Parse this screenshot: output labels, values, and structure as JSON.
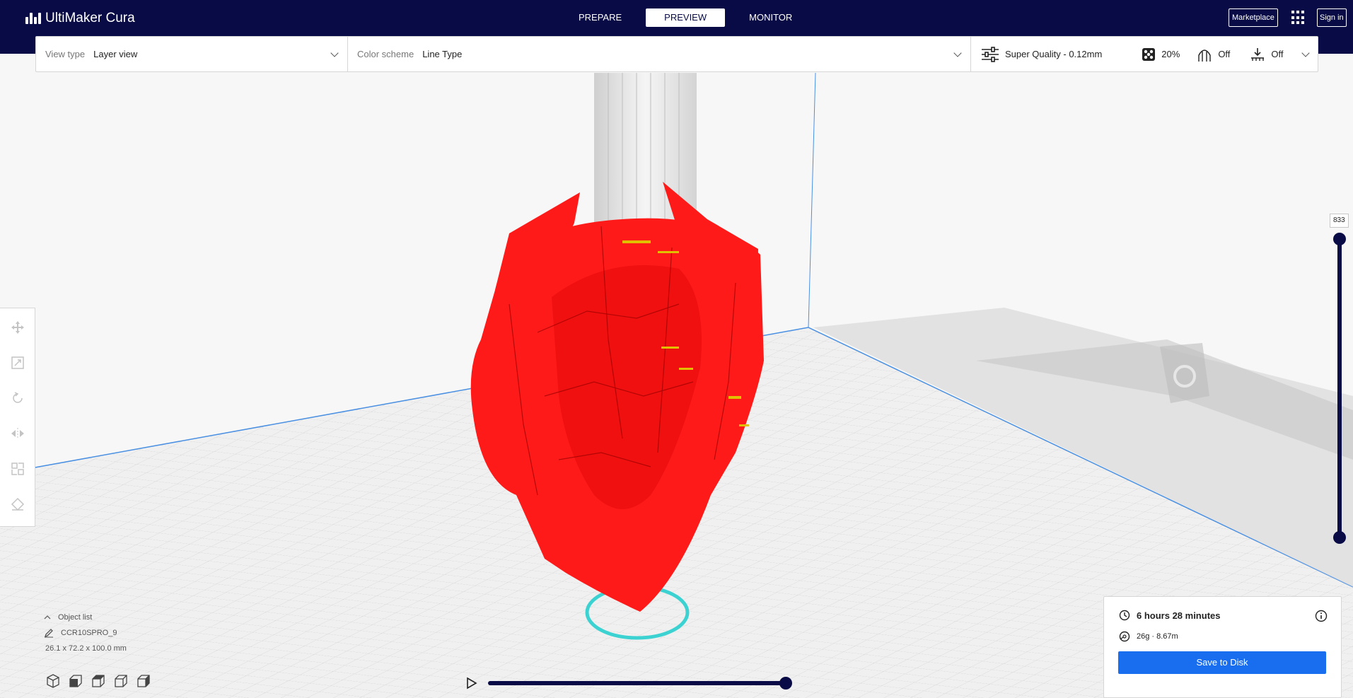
{
  "app": {
    "title": "UltiMaker Cura"
  },
  "nav": {
    "tabs": [
      "PREPARE",
      "PREVIEW",
      "MONITOR"
    ],
    "active": "PREVIEW"
  },
  "header": {
    "marketplace": "Marketplace",
    "sign_in": "Sign in"
  },
  "options": {
    "view_type_label": "View type",
    "view_type_value": "Layer view",
    "color_scheme_label": "Color scheme",
    "color_scheme_value": "Line Type"
  },
  "print_setup": {
    "profile": "Super Quality - 0.12mm",
    "infill": "20%",
    "support": "Off",
    "adhesion": "Off"
  },
  "layer_view": {
    "current_layer": "833"
  },
  "object": {
    "list_label": "Object list",
    "name": "CCR10SPRO_9",
    "dimensions": "26.1 x 72.2 x 100.0 mm"
  },
  "estimate": {
    "time": "6 hours 28 minutes",
    "material": "26g · 8.67m",
    "save_label": "Save to Disk"
  },
  "colors": {
    "header": "#080b45",
    "accent": "#196ef0",
    "model": "#ff1a1a",
    "infill": "#e0c000",
    "skirt": "#3cd2d2",
    "grid_line": "#c8c8c8"
  },
  "icons": {
    "toolbar": [
      "move-icon",
      "scale-icon",
      "rotate-icon",
      "mirror-icon",
      "per-model-settings-icon",
      "support-blocker-icon"
    ],
    "view_cubes": [
      "view-3d-icon",
      "view-front-icon",
      "view-top-icon",
      "view-left-icon",
      "view-right-icon"
    ]
  }
}
